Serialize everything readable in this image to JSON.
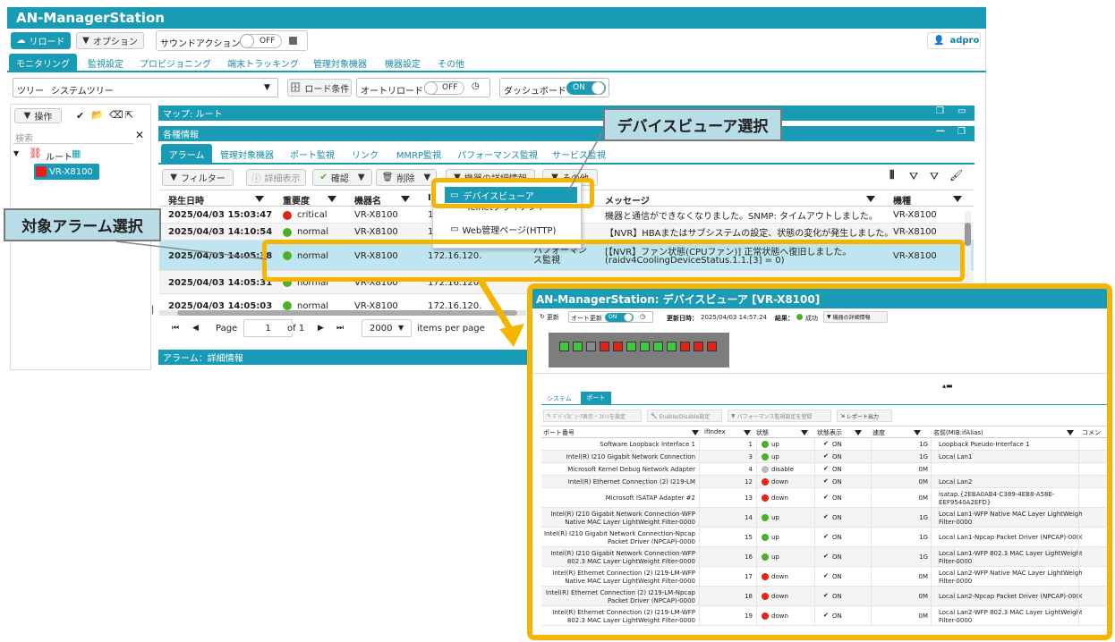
{
  "app": {
    "title": "AN-ManagerStation",
    "reload": "リロード",
    "option": "オプション",
    "sound_action": "サウンドアクション",
    "sound_state": "OFF",
    "user": "adpro"
  },
  "nav_tabs": [
    "モニタリング",
    "監視設定",
    "プロビジョニング",
    "端末トラッキング",
    "管理対象機器",
    "機器設定",
    "その他"
  ],
  "toolbar2": {
    "tree_label": "ツリー",
    "tree_value": "システムツリー",
    "load_cond": "ロード条件",
    "auto_reload": "オートリロード",
    "auto_state": "OFF",
    "dashboard": "ダッシュボード",
    "dash_state": "ON"
  },
  "sidebar": {
    "ops": "操作",
    "search_placeholder": "検索",
    "root": "ルート",
    "device": "VR-X8100"
  },
  "map_bar": "マップ: ルート",
  "info_bar": "各種情報",
  "info_tabs": [
    "アラーム",
    "管理対象機器",
    "ポート監視",
    "リンク",
    "MMRP監視",
    "パフォーマンス監視",
    "サービス監視"
  ],
  "alarm_toolbar": {
    "filter": "フィルター",
    "detail": "詳細表示",
    "confirm": "確認",
    "delete": "削除",
    "device_detail": "機器の詳細情報",
    "other": "その他"
  },
  "alarm_columns": [
    "発生日時",
    "重要度",
    "機器名",
    "I",
    "メッセージ",
    "機種"
  ],
  "alarm_rows": [
    {
      "time": "2025/04/03 15:03:47",
      "sev": "critical",
      "sev_color": "#e0231b",
      "dev": "VR-X8100",
      "ip": "172.1",
      "cat": "",
      "msg": "機器と通信ができなくなりました。SNMP: タイムアウトしました。",
      "model": "VR-X8100"
    },
    {
      "time": "2025/04/03 14:10:54",
      "sev": "normal",
      "sev_color": "#4caf28",
      "dev": "VR-X8100",
      "ip": "172.1",
      "cat": "",
      "msg": "【NVR】HBAまたはサブシステムの設定、状態の変化が発生しました。",
      "model": "VR-X8100"
    },
    {
      "time": "2025/04/03 14:05:38",
      "sev": "normal",
      "sev_color": "#4caf28",
      "dev": "VR-X8100",
      "ip": "172.16.120.3",
      "cat": "パフォーマンス監視",
      "msg": "[【NVR】ファン状態(CPUファン)] 正常状態へ復旧しました。",
      "msg2": "(raidv4CoolingDeviceStatus.1.1.[3] = 0)",
      "model": "VR-X8100"
    },
    {
      "time": "2025/04/03 14:05:31",
      "sev": "normal",
      "sev_color": "#4caf28",
      "dev": "VR-X8100",
      "ip": "172.16.120.3",
      "cat": "",
      "msg": "",
      "model": ""
    },
    {
      "time": "2025/04/03 14:05:03",
      "sev": "normal",
      "sev_color": "#4caf28",
      "dev": "VR-X8100",
      "ip": "172.16.120.3",
      "cat": "",
      "msg": "",
      "model": ""
    }
  ],
  "context_menu": [
    "デバイスビューア",
    "Telnetクライアント",
    "Web管理ページ(HTTP)"
  ],
  "pager": {
    "page_label": "Page",
    "page": "1",
    "of": "of 1",
    "size": "2000",
    "per": "items per page"
  },
  "detail_bar": "アラーム：詳細情報",
  "callouts": {
    "device_viewer": "デバイスビューア選択",
    "alarm_select": "対象アラーム選択"
  },
  "dv": {
    "title": "AN-ManagerStation: デバイスビューア [VR-X8100]",
    "refresh": "更新",
    "auto": "オート更新",
    "auto_state": "ON",
    "updated_label": "更新日時：",
    "updated": "2025/04/03 14:57:24",
    "result_label": "結果：",
    "result": "成功",
    "device_detail": "機器の詳細情報",
    "tabs": [
      "システム",
      "ポート"
    ],
    "actions": [
      "ﾃﾞﾊﾞｲｽﾋﾞｭｰｱ表示・ｺﾒﾝﾄを設定",
      "Enable/Disable設定",
      "パフォーマンス監視設定を登録",
      "レポート出力"
    ],
    "columns": [
      "ポート番号",
      "ifIndex",
      "状態",
      "状態表示",
      "速度",
      "名前(MIB:ifAlias)",
      "コメン"
    ],
    "ports": [
      {
        "name": "Software Loopback Interface 1",
        "idx": "1",
        "st": "up",
        "c": "#4caf28",
        "on": "ON",
        "sp": "1G",
        "alias": "Loopback Pseudo-Interface 1"
      },
      {
        "name": "Intel(R) I210 Gigabit Network Connection",
        "idx": "3",
        "st": "up",
        "c": "#4caf28",
        "on": "ON",
        "sp": "1G",
        "alias": "Local Lan1"
      },
      {
        "name": "Microsoft Kernel Debug Network Adapter",
        "idx": "4",
        "st": "disable",
        "c": "#bdbdbd",
        "on": "ON",
        "sp": "0M",
        "alias": ""
      },
      {
        "name": "Intel(R) Ethernet Connection (2) I219-LM",
        "idx": "12",
        "st": "down",
        "c": "#e0231b",
        "on": "ON",
        "sp": "0M",
        "alias": "Local Lan2"
      },
      {
        "name": "Microsoft ISATAP Adapter #2",
        "idx": "13",
        "st": "down",
        "c": "#e0231b",
        "on": "ON",
        "sp": "0M",
        "alias": "isatap.{2EBA0AB4-C389-4EB8-A58E-",
        "alias2": "EEF9540A2EFD}"
      },
      {
        "name": "Intel(R) I210 Gigabit Network Connection-WFP",
        "name2": "Native MAC Layer LightWeight Filter-0000",
        "idx": "14",
        "st": "up",
        "c": "#4caf28",
        "on": "ON",
        "sp": "1G",
        "alias": "Local Lan1-WFP Native MAC Layer LightWeight",
        "alias2": "Filter-0000"
      },
      {
        "name": "Intel(R) I210 Gigabit Network Connection-Npcap",
        "name2": "Packet Driver (NPCAP)-0000",
        "idx": "15",
        "st": "up",
        "c": "#4caf28",
        "on": "ON",
        "sp": "1G",
        "alias": "Local Lan1-Npcap Packet Driver (NPCAP)-0000"
      },
      {
        "name": "Intel(R) I210 Gigabit Network Connection-WFP",
        "name2": "802.3 MAC Layer LightWeight Filter-0000",
        "idx": "16",
        "st": "up",
        "c": "#4caf28",
        "on": "ON",
        "sp": "1G",
        "alias": "Local Lan1-WFP 802.3 MAC Layer LightWeight",
        "alias2": "Filter-0000"
      },
      {
        "name": "Intel(R) Ethernet Connection (2) I219-LM-WFP",
        "name2": "Native MAC Layer LightWeight Filter-0000",
        "idx": "17",
        "st": "down",
        "c": "#e0231b",
        "on": "ON",
        "sp": "0M",
        "alias": "Local Lan2-WFP Native MAC Layer LightWeight",
        "alias2": "Filter-0000"
      },
      {
        "name": "Intel(R) Ethernet Connection (2) I219-LM-Npcap",
        "name2": "Packet Driver (NPCAP)-0000",
        "idx": "18",
        "st": "down",
        "c": "#e0231b",
        "on": "ON",
        "sp": "0M",
        "alias": "Local Lan2-Npcap Packet Driver (NPCAP)-0000"
      },
      {
        "name": "Intel(R) Ethernet Connection (2) I219-LM-WFP",
        "name2": "802.3 MAC Layer LightWeight Filter-0000",
        "idx": "19",
        "st": "down",
        "c": "#e0231b",
        "on": "ON",
        "sp": "0M",
        "alias": "Local Lan2-WFP 802.3 MAC Layer LightWeight",
        "alias2": "Filter-0000"
      }
    ],
    "leds": [
      "#3fc83f",
      "#3fc83f",
      "#8a8a8a",
      "#e0231b",
      "#e0231b",
      "#3fc83f",
      "#3fc83f",
      "#3fc83f",
      "#3fc83f",
      "#e0231b",
      "#e0231b",
      "#e0231b"
    ]
  },
  "colors": {
    "accent": "#1a9bb5",
    "highlight": "#f5b400",
    "selected_row": "#bfe6f0"
  }
}
